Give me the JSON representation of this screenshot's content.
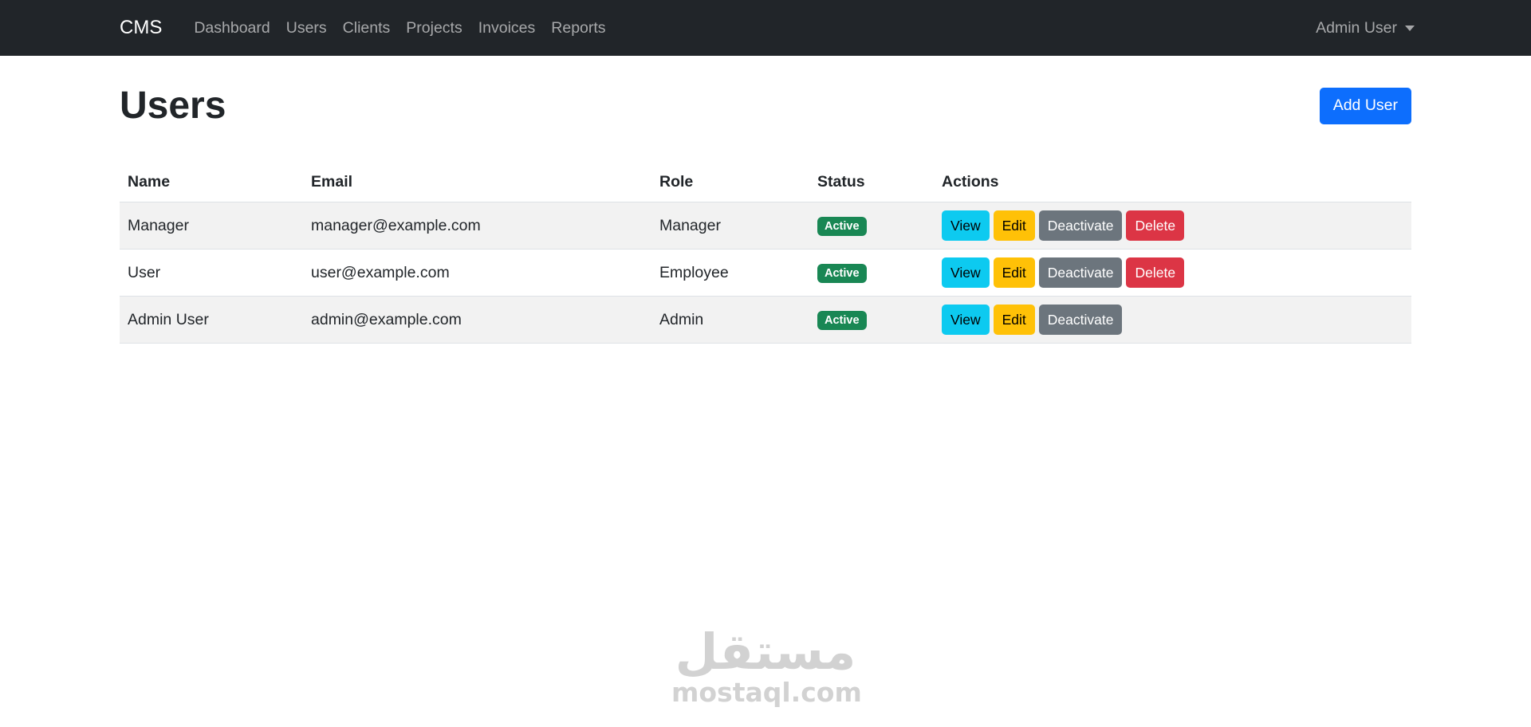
{
  "navbar": {
    "brand": "CMS",
    "links": [
      "Dashboard",
      "Users",
      "Clients",
      "Projects",
      "Invoices",
      "Reports"
    ],
    "user_menu": "Admin User"
  },
  "page": {
    "title": "Users",
    "add_button": "Add User"
  },
  "table": {
    "headers": [
      "Name",
      "Email",
      "Role",
      "Status",
      "Actions"
    ],
    "rows": [
      {
        "name": "Manager",
        "email": "manager@example.com",
        "role": "Manager",
        "status": "Active",
        "actions": [
          "View",
          "Edit",
          "Deactivate",
          "Delete"
        ]
      },
      {
        "name": "User",
        "email": "user@example.com",
        "role": "Employee",
        "status": "Active",
        "actions": [
          "View",
          "Edit",
          "Deactivate",
          "Delete"
        ]
      },
      {
        "name": "Admin User",
        "email": "admin@example.com",
        "role": "Admin",
        "status": "Active",
        "actions": [
          "View",
          "Edit",
          "Deactivate"
        ]
      }
    ]
  },
  "watermark": {
    "logo_text": "مستقل",
    "domain": "mostaql.com"
  },
  "colors": {
    "navbar_bg": "#212529",
    "primary": "#0d6efd",
    "success": "#198754",
    "info": "#0dcaf0",
    "warning": "#ffc107",
    "secondary": "#6c757d",
    "danger": "#dc3545"
  }
}
